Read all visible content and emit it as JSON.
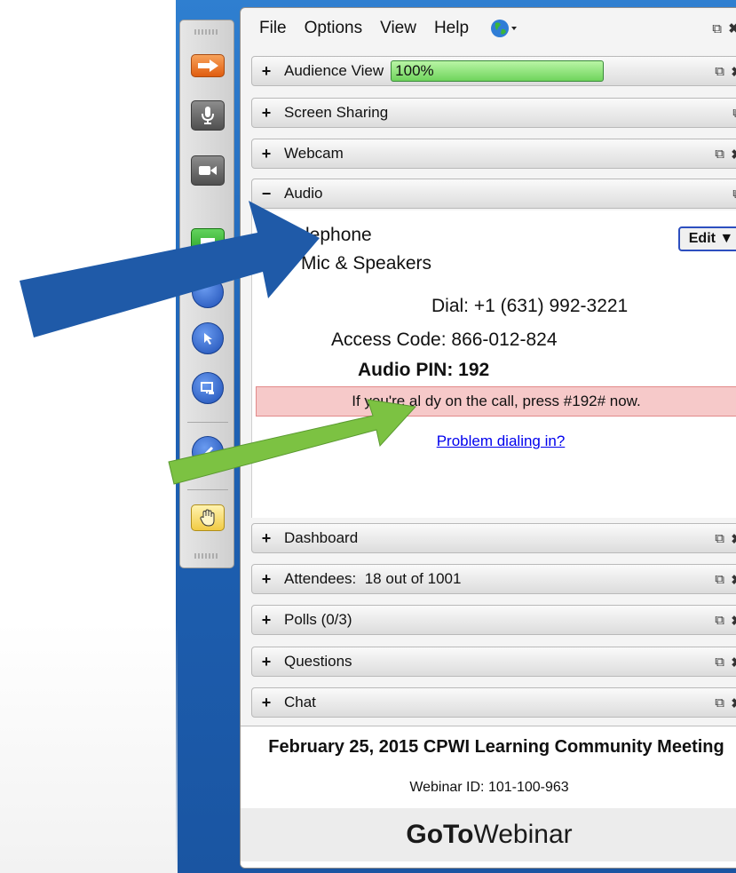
{
  "menu": {
    "file": "File",
    "options": "Options",
    "view": "View",
    "help": "Help"
  },
  "icons": {
    "globe": "globe-icon",
    "popout": "popout-icon",
    "close": "close-icon"
  },
  "panels": {
    "audience_view": "Audience View",
    "audience_progress": "100%",
    "screen_sharing": "Screen Sharing",
    "webcam": "Webcam",
    "audio": "Audio",
    "dashboard": "Dashboard",
    "attendees": "Attendees:  18 out of 1001",
    "polls": "Polls (0/3)",
    "questions": "Questions",
    "chat": "Chat"
  },
  "audio": {
    "option_telephone": "lephone",
    "option_mic": "Mic & Speakers",
    "edit_label": "Edit ▼",
    "dial": "Dial: +1 (631) 992-3221",
    "access_code": "Access Code: 866-012-824",
    "audio_pin": "Audio PIN: 192",
    "notice": "If you're al    dy on the call, press #192# now.",
    "problem_link": "Problem dialing in?"
  },
  "footer": {
    "title": "February 25, 2015 CPWI Learning Community Meeting",
    "webinar_id": "Webinar ID: 101-100-963",
    "brand_goto": "GoTo",
    "brand_webinar": "Webinar"
  },
  "colors": {
    "blue_arrow": "#1f5aa8",
    "green_arrow": "#7cc242",
    "progress": "#7ed86a",
    "notice_bg": "#f6c9c9"
  }
}
